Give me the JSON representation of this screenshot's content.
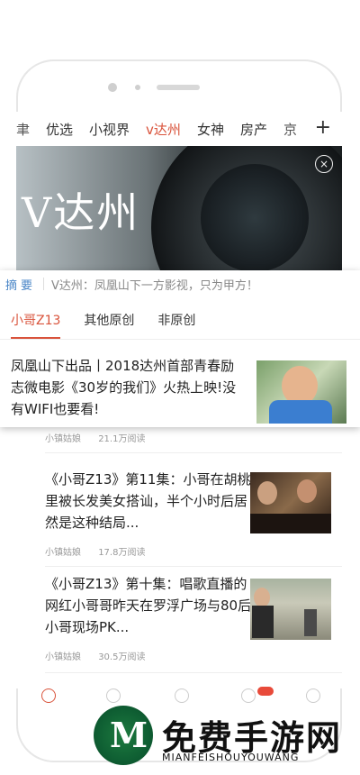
{
  "nav": {
    "tabs": [
      {
        "label": "聿",
        "state": "cut"
      },
      {
        "label": "优选",
        "state": "normal"
      },
      {
        "label": "小视界",
        "state": "normal"
      },
      {
        "label": "v达州",
        "state": "active"
      },
      {
        "label": "女神",
        "state": "normal"
      },
      {
        "label": "房产",
        "state": "normal"
      },
      {
        "label": "京",
        "state": "cut"
      }
    ],
    "add_glyph": "+"
  },
  "banner": {
    "text": "V达州",
    "close_glyph": "×"
  },
  "summary": {
    "tag": "摘要",
    "text": "V达州：凤凰山下一方影视，只为甲方！"
  },
  "subtabs": [
    "小哥Z13",
    "其他原创",
    "非原创"
  ],
  "featured": {
    "title": "凤凰山下出品丨2018达州首部青春励志微电影《30岁的我们》火热上映!没有WIFI也要看!"
  },
  "articles": [
    {
      "title": "",
      "source": "小镇姑娘",
      "reads": "21.1万阅读"
    },
    {
      "title": "《小哥Z13》第11集：小哥在胡桃里被长发美女搭讪，半个小时后居然是这种结局...",
      "source": "小镇姑娘",
      "reads": "17.8万阅读"
    },
    {
      "title": "《小哥Z13》第十集：唱歌直播的网红小哥哥昨天在罗浮广场与80后小哥现场PK...",
      "source": "小镇姑娘",
      "reads": "30.5万阅读"
    }
  ],
  "brand": {
    "name": "免费手游网",
    "sub": "MIANFEISHOUYOUWANG",
    "logo_letter": "M"
  },
  "colors": {
    "accent": "#d9533b",
    "summary_tag": "#4a86c7",
    "badge": "#e84a3a"
  }
}
